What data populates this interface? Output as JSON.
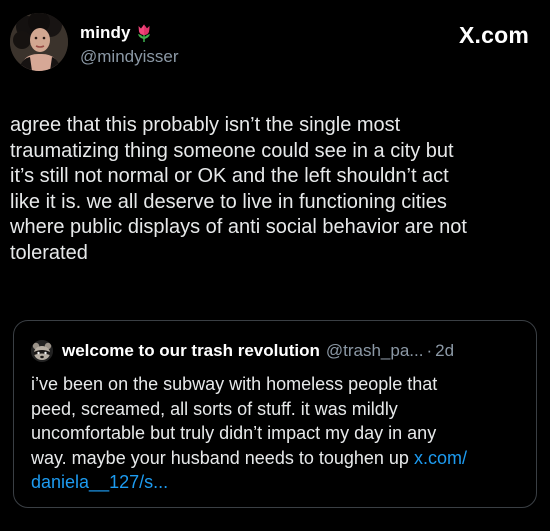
{
  "author": {
    "display_name": "mindy",
    "emoji_icon": "tulip-icon",
    "handle": "@mindyisser"
  },
  "brand": {
    "label": "X.com"
  },
  "tweet": {
    "text": "agree that this probably isn’t the single most\ntraumatizing thing someone could see in a city but\nit’s still not normal or OK and the left shouldn’t act\nlike it is. we all deserve to live in functioning cities\nwhere public displays of anti social behavior are not\ntolerated"
  },
  "quoted": {
    "display_name": "welcome to our trash revolution",
    "handle": "@trash_pa...",
    "separator": "·",
    "time": "2d",
    "text": "i’ve been on the subway with homeless people that\npeed, screamed, all sorts of stuff. it was mildly\nuncomfortable but truly didn’t impact my day in any\nway. maybe your husband needs to toughen up ",
    "link": "x.com/\ndaniela__127/s..."
  },
  "colors": {
    "background": "#000000",
    "text": "#e7e9ea",
    "secondary": "#8b98a5",
    "link": "#1d9bf0",
    "border": "#3a3f44"
  }
}
